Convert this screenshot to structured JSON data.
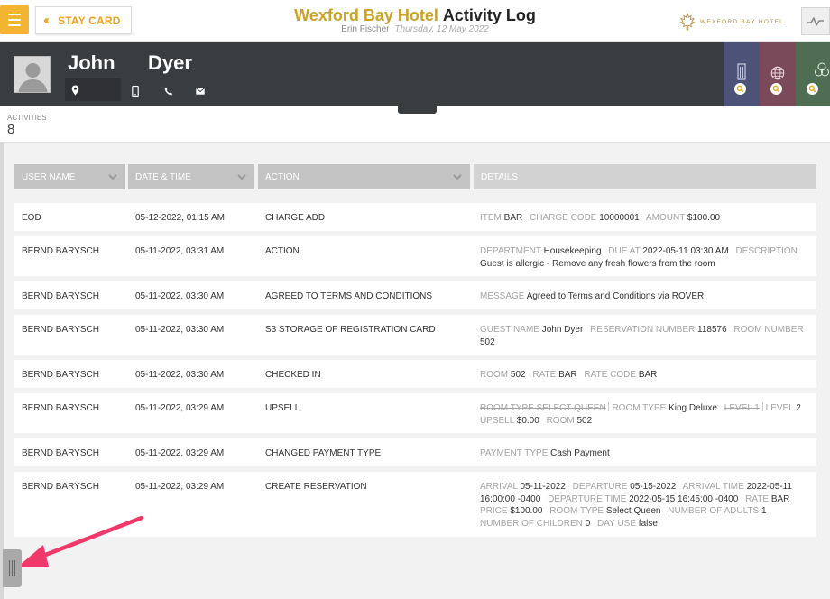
{
  "header": {
    "stay_card_label": "STAY CARD",
    "hotel_name": "Wexford Bay Hotel",
    "page_title": "Activity Log",
    "user_name": "Erin Fischer",
    "date": "Thursday, 12 May 2022",
    "brand_name": "WEXFORD BAY HOTEL",
    "accent_color": "#f2b431"
  },
  "guest": {
    "first_name": "John",
    "last_name": "Dyer",
    "icons": [
      "location-icon",
      "mobile-phone-icon",
      "phone-icon",
      "email-icon"
    ],
    "tiles": [
      {
        "name": "building",
        "color": "#4d5378"
      },
      {
        "name": "globe",
        "color": "#7a4a5a"
      },
      {
        "name": "circles",
        "color": "#4f6d52"
      }
    ]
  },
  "activities": {
    "label": "ACTIVITIES",
    "count": "8"
  },
  "table": {
    "columns": [
      "USER NAME",
      "DATE & TIME",
      "ACTION",
      "DETAILS"
    ],
    "rows": [
      {
        "user": "EOD",
        "datetime": "05-12-2022, 01:15 AM",
        "action": "CHARGE ADD",
        "details": [
          {
            "k": "ITEM",
            "v": "BAR"
          },
          {
            "k": "CHARGE CODE",
            "v": "10000001"
          },
          {
            "k": "AMOUNT",
            "v": "$100.00"
          }
        ]
      },
      {
        "user": "BERND BARYSCH",
        "datetime": "05-11-2022, 03:31 AM",
        "action": "ACTION",
        "details": [
          {
            "k": "DEPARTMENT",
            "v": "Housekeeping"
          },
          {
            "k": "DUE AT",
            "v": "2022-05-11 03:30 AM"
          },
          {
            "k": "DESCRIPTION",
            "v": "Guest is allergic - Remove any fresh flowers from the room"
          }
        ]
      },
      {
        "user": "BERND BARYSCH",
        "datetime": "05-11-2022, 03:30 AM",
        "action": "AGREED TO TERMS AND CONDITIONS",
        "details": [
          {
            "k": "MESSAGE",
            "v": "Agreed to Terms and Conditions via ROVER"
          }
        ]
      },
      {
        "user": "BERND BARYSCH",
        "datetime": "05-11-2022, 03:30 AM",
        "action": "S3 STORAGE OF REGISTRATION CARD",
        "details": [
          {
            "k": "GUEST NAME",
            "v": "John Dyer"
          },
          {
            "k": "RESERVATION NUMBER",
            "v": "118576"
          },
          {
            "k": "ROOM NUMBER",
            "v": "502"
          }
        ]
      },
      {
        "user": "BERND BARYSCH",
        "datetime": "05-11-2022, 03:30 AM",
        "action": "CHECKED IN",
        "details": [
          {
            "k": "ROOM",
            "v": "502"
          },
          {
            "k": "RATE",
            "v": "BAR"
          },
          {
            "k": "RATE CODE",
            "v": "BAR"
          }
        ]
      },
      {
        "user": "BERND BARYSCH",
        "datetime": "05-11-2022, 03:29 AM",
        "action": "UPSELL",
        "details": [
          {
            "k": "ROOM TYPE SELECT QUEEN",
            "v": "",
            "strike": true,
            "sep": true
          },
          {
            "k": "ROOM TYPE",
            "v": "King Deluxe"
          },
          {
            "k": "LEVEL 1",
            "v": "",
            "strike": true,
            "sep": true
          },
          {
            "k": "LEVEL",
            "v": "2"
          },
          {
            "k": "UPSELL",
            "v": "$0.00"
          },
          {
            "k": "ROOM",
            "v": "502"
          }
        ]
      },
      {
        "user": "BERND BARYSCH",
        "datetime": "05-11-2022, 03:29 AM",
        "action": "CHANGED PAYMENT TYPE",
        "details": [
          {
            "k": "PAYMENT TYPE",
            "v": "Cash Payment"
          }
        ]
      },
      {
        "user": "BERND BARYSCH",
        "datetime": "05-11-2022, 03:29 AM",
        "action": "CREATE RESERVATION",
        "details": [
          {
            "k": "ARRIVAL",
            "v": "05-11-2022"
          },
          {
            "k": "DEPARTURE",
            "v": "05-15-2022"
          },
          {
            "k": "ARRIVAL TIME",
            "v": "2022-05-11 16:00:00 -0400"
          },
          {
            "k": "DEPARTURE TIME",
            "v": "2022-05-15 16:45:00 -0400"
          },
          {
            "k": "RATE",
            "v": "BAR"
          },
          {
            "k": "PRICE",
            "v": "$100.00"
          },
          {
            "k": "ROOM TYPE",
            "v": "Select Queen"
          },
          {
            "k": "NUMBER OF ADULTS",
            "v": "1"
          },
          {
            "k": "NUMBER OF CHILDREN",
            "v": "0"
          },
          {
            "k": "DAY USE",
            "v": "false"
          }
        ]
      }
    ]
  },
  "annotation": {
    "arrow_color": "#f0386b"
  }
}
